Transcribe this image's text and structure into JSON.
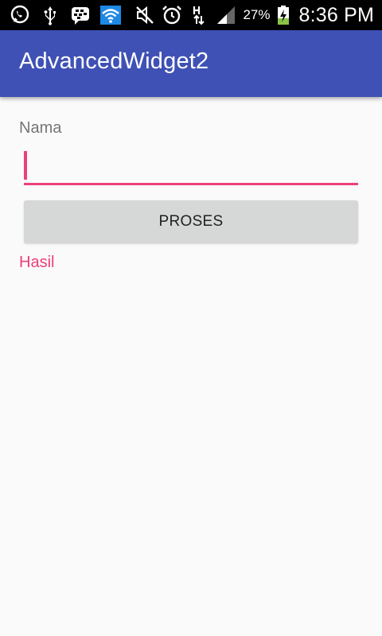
{
  "status_bar": {
    "icons": [
      "whatsapp-icon",
      "usb-icon",
      "bbm-icon",
      "wifi-icon",
      "mute-icon",
      "alarm-icon",
      "data-transfer-icon",
      "signal-icon",
      "battery-charging-icon"
    ],
    "battery_percent": "27%",
    "time": "8:36 PM"
  },
  "app_bar": {
    "title": "AdvancedWidget2",
    "color": "#3f51b5"
  },
  "form": {
    "name_label": "Nama",
    "name_value": "",
    "name_placeholder": "",
    "accent_color": "#ec407a",
    "button_label": "PROSES",
    "result_text": "Hasil"
  }
}
